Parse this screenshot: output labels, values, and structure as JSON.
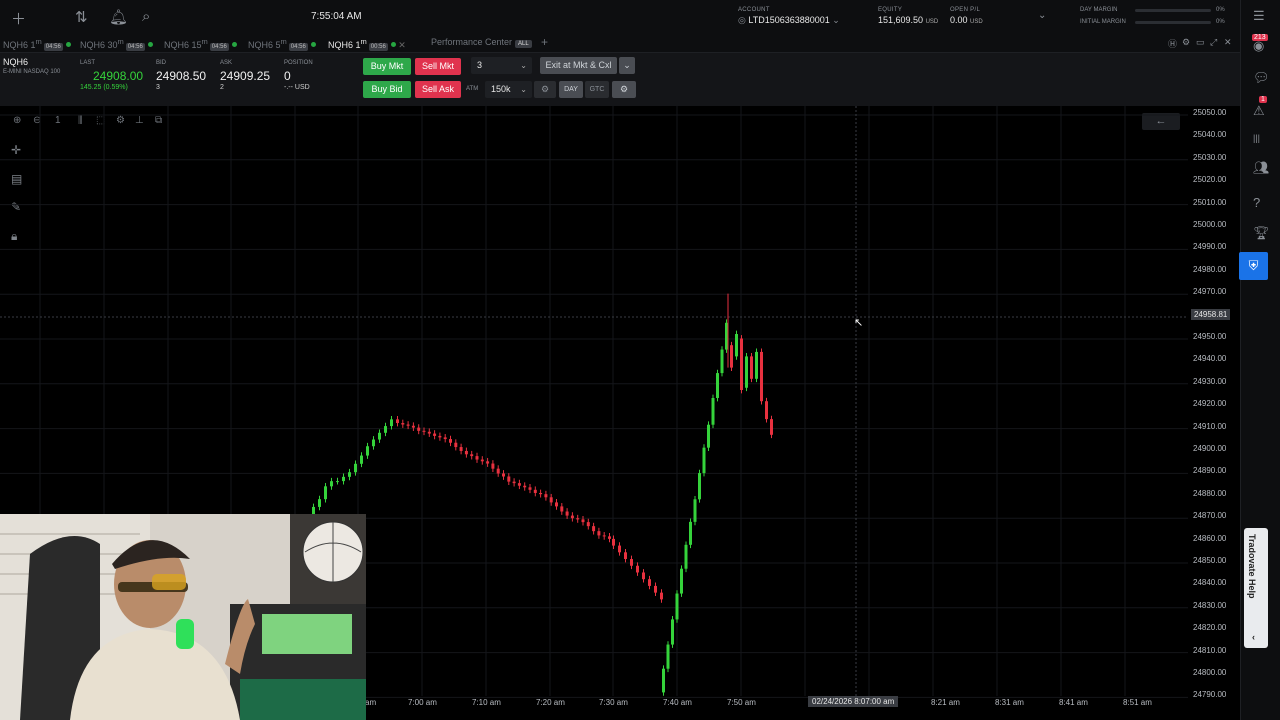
{
  "topbar": {
    "time": "7:55:04 AM",
    "account_label": "ACCOUNT",
    "account_value": "LTD1506363880001",
    "equity_label": "EQUITY",
    "equity_value": "151,609.50",
    "equity_ccy": "USD",
    "openpl_label": "OPEN P/L",
    "openpl_value": "0.00",
    "openpl_ccy": "USD",
    "day_margin_label": "DAY MARGIN",
    "day_margin_pct": "0%",
    "initial_margin_label": "INITIAL MARGIN",
    "initial_margin_pct": "0%"
  },
  "tabs": [
    {
      "label": "NQH6 1",
      "sup": "m",
      "time": "04:56"
    },
    {
      "label": "NQH6 30",
      "sup": "m",
      "time": "04:56"
    },
    {
      "label": "NQH6 15",
      "sup": "m",
      "time": "04:56"
    },
    {
      "label": "NQH6 5",
      "sup": "m",
      "time": "04:56"
    },
    {
      "label": "NQH6 1",
      "sup": "m",
      "time": "00:56"
    },
    {
      "label": "Performance Center",
      "badge": "ALL"
    }
  ],
  "quote": {
    "symbol": "NQH6",
    "description": "E-MINI NASDAQ 100",
    "last_label": "LAST",
    "last": "24908.00",
    "change": "145.25 (0.59%)",
    "bid_label": "BID",
    "bid": "24908.50",
    "bid_size": "3",
    "ask_label": "ASK",
    "ask": "24909.25",
    "ask_size": "2",
    "position_label": "POSITION",
    "position": "0",
    "position_sub": "-.-- USD"
  },
  "order": {
    "buy_mkt": "Buy Mkt",
    "sell_mkt": "Sell Mkt",
    "buy_bid": "Buy Bid",
    "sell_ask": "Sell Ask",
    "qty": "3",
    "atm_label": "ATM",
    "atm_value": "150k",
    "exit_label": "Exit at Mkt & Cxl",
    "day": "DAY",
    "gtc": "GTC"
  },
  "chart_toolbar": {
    "interval": "1"
  },
  "chart": {
    "y_ticks": [
      "25050.00",
      "25040.00",
      "25030.00",
      "25020.00",
      "25010.00",
      "25000.00",
      "24990.00",
      "24980.00",
      "24970.00",
      "24960.00",
      "24950.00",
      "24940.00",
      "24930.00",
      "24920.00",
      "24910.00",
      "24900.00",
      "24890.00",
      "24880.00",
      "24870.00",
      "24860.00",
      "24850.00",
      "24840.00",
      "24830.00",
      "24820.00",
      "24810.00",
      "24800.00",
      "24790.00"
    ],
    "x_ticks": [
      "am",
      "7:00 am",
      "7:10 am",
      "7:20 am",
      "7:30 am",
      "7:40 am",
      "7:50 am",
      "8:21 am",
      "8:31 am",
      "8:41 am",
      "8:51 am"
    ],
    "crosshair_time": "02/24/2026 8:07:00 am",
    "crosshair_price": "24958.81"
  },
  "sidebar": {
    "notifications_badge": "213",
    "alerts_badge": "1",
    "help_label": "Tradovate Help"
  },
  "colors": {
    "up": "#35d33b",
    "down": "#e8313f",
    "accent": "#1a73e8"
  }
}
